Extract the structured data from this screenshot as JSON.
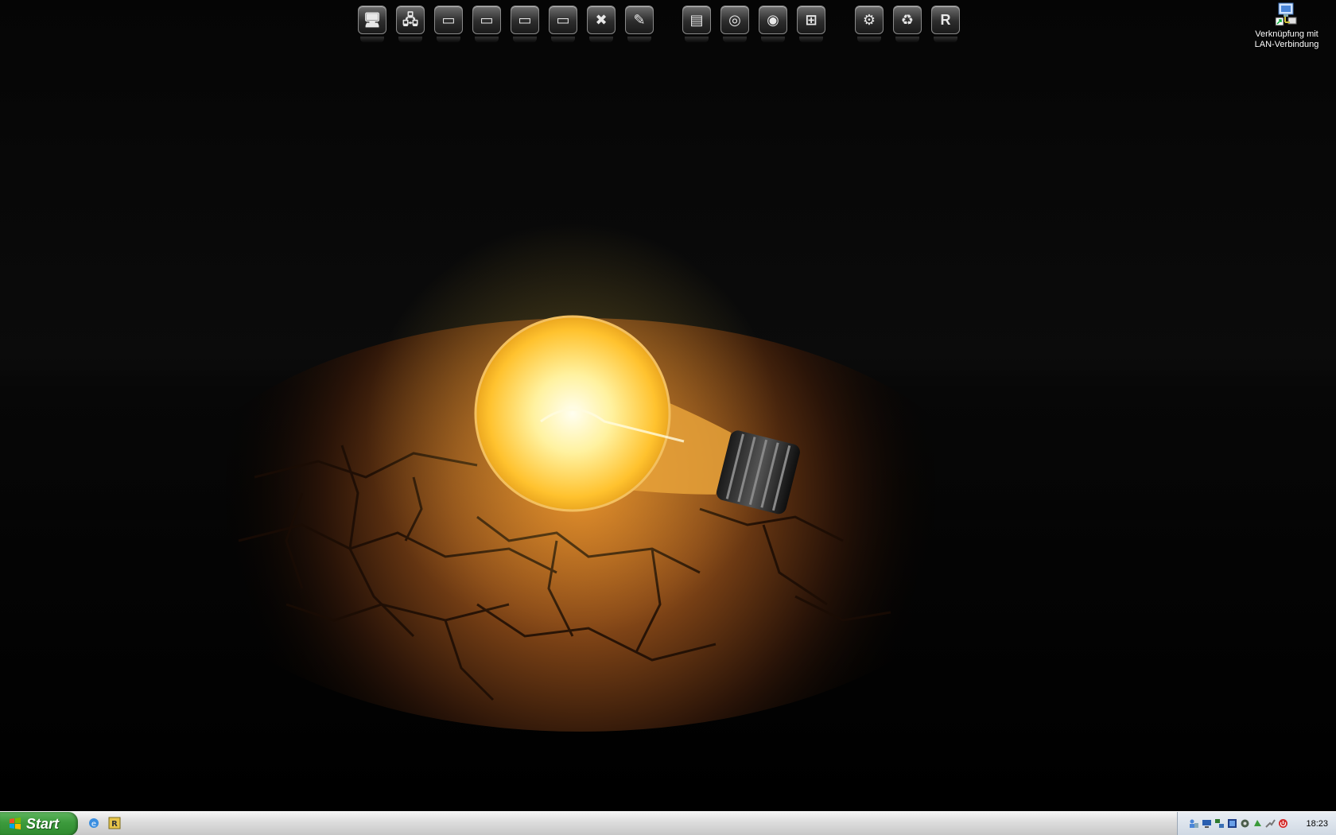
{
  "desktop": {
    "shortcut": {
      "label_line1": "Verknüpfung mit",
      "label_line2": "LAN-Verbindung",
      "icon": "network-connection-icon"
    }
  },
  "dock": {
    "items": [
      {
        "icon": "my-computer-icon",
        "glyph": "🖥"
      },
      {
        "icon": "network-places-icon",
        "glyph": "🖧"
      },
      {
        "icon": "drive-c-icon",
        "glyph": "▭"
      },
      {
        "icon": "drive-d-icon",
        "glyph": "▭"
      },
      {
        "icon": "drive-e-icon",
        "glyph": "▭"
      },
      {
        "icon": "drive-f-icon",
        "glyph": "▭"
      },
      {
        "icon": "xp-tools-icon",
        "glyph": "✖"
      },
      {
        "icon": "notepad-icon",
        "glyph": "✎"
      },
      {
        "icon": "explorer-window-icon",
        "glyph": "▤"
      },
      {
        "icon": "chrome-icon",
        "glyph": "◎"
      },
      {
        "icon": "media-player-icon",
        "glyph": "◉"
      },
      {
        "icon": "windows-icon",
        "glyph": "⊞"
      },
      {
        "icon": "control-panel-icon",
        "glyph": "⚙"
      },
      {
        "icon": "recycle-bin-icon",
        "glyph": "♻"
      },
      {
        "icon": "rocketdock-icon",
        "glyph": "R"
      }
    ]
  },
  "taskbar": {
    "start_label": "Start",
    "quicklaunch": [
      {
        "icon": "internet-explorer-icon"
      },
      {
        "icon": "rocketdock-quicklaunch-icon"
      }
    ],
    "tray_icons": [
      "network-users-icon",
      "monitor-icon",
      "network-icon",
      "display-icon",
      "security-icon",
      "sync-icon",
      "connection-icon",
      "power-icon"
    ],
    "clock": "18:23"
  },
  "colors": {
    "start_green": "#3c9a3c",
    "taskbar_gray": "#dcdcdc",
    "bulb_glow": "#ffd24a"
  }
}
